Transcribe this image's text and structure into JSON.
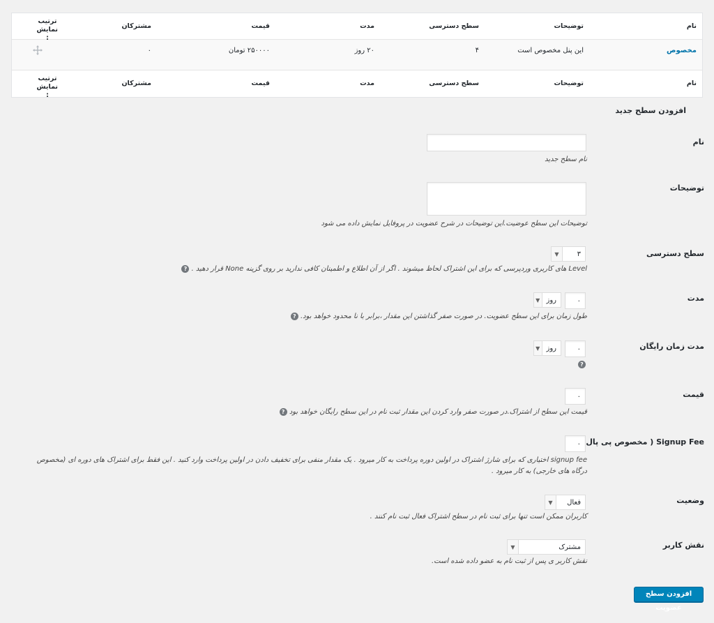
{
  "table": {
    "headers": {
      "name": "نام",
      "description": "توضیحات",
      "access": "سطح دسترسی",
      "duration": "مدت",
      "price": "قیمت",
      "subscribers": "مشترکان",
      "order": "ترتیب نمایش :"
    },
    "rows": [
      {
        "name": "مخصوص",
        "description": "این پنل مخصوص است",
        "access": "۴",
        "duration": "۲۰ روز",
        "price": "۲۵۰۰۰۰ تومان",
        "subscribers": "۰"
      }
    ]
  },
  "form": {
    "title": "افزودن سطح جدید",
    "name": {
      "label": "نام",
      "value": "",
      "help": "نام سطح جدید"
    },
    "description": {
      "label": "توضیحات",
      "value": "",
      "help": "توضیحات این سطح عوضیت.این توضیحات در شرح عضویت در پروفایل نمایش داده می شود"
    },
    "access": {
      "label": "سطح دسترسی",
      "value": "۳",
      "help": "Level های کاربری وردپرسی که برای این اشتراک لحاظ میشوند . اگر از آن اطلاع و اطمینان کافی ندارید بر روی گزینه None قرار دهید ."
    },
    "duration": {
      "label": "مدت",
      "value": "۰",
      "unit": "روز",
      "help": "طول زمان برای این سطح عضویت. در صورت صفر گذاشتن این مقدار ،برابر با نا محدود خواهد بود."
    },
    "trial": {
      "label": "مدت زمان رایگان",
      "value": "۰",
      "unit": "روز"
    },
    "price": {
      "label": "قیمت",
      "value": "۰",
      "help": "قیمت این سطح از اشتراک.در صورت صفر وارد کردن این مقدار ثبت نام در این سطح رایگان خواهد بود"
    },
    "signup_fee": {
      "label": "Signup Fee ( مخصوص پی پال)",
      "value": "۰",
      "help": "signup fee اختیاری که برای شارژ اشتراک در اولین دوره پرداخت به کار میرود . یک مقدار منفی برای تخفیف دادن در اولین پرداخت وارد کنید . این فقط برای اشتراک های دوره ای (مخصوص درگاه های خارجی) به کار میرود ."
    },
    "status": {
      "label": "وضعیت",
      "value": "فعال",
      "help": "کاربران ممکن است تنها برای ثبت نام در سطح اشتراک فعال ثبت نام کنند ."
    },
    "role": {
      "label": "نقش کاربر",
      "value": "مشترک",
      "help": "نقش کاربر ی پس از ثبت نام به عضو داده شده است."
    },
    "submit": "افزودن سطح عضویت",
    "help_icon": "?"
  },
  "colors": {
    "accent": "#0085ba",
    "link": "#0073aa"
  }
}
